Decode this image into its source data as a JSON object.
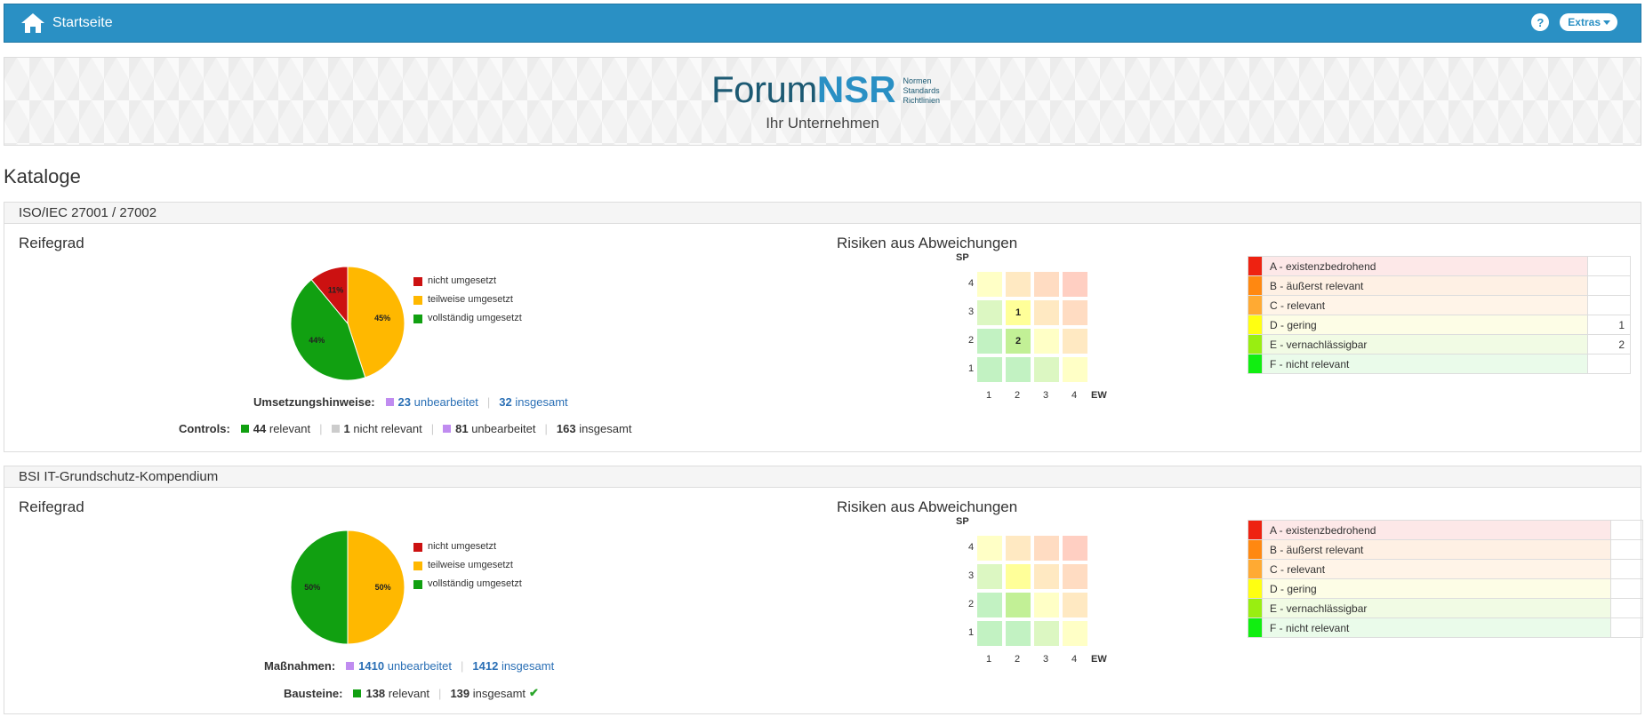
{
  "topbar": {
    "home_label": "Startseite",
    "help_label": "?",
    "extras_label": "Extras"
  },
  "banner": {
    "logo_forum": "Forum",
    "logo_nsr": "NSR",
    "logo_tag": [
      "Normen",
      "Standards",
      "Richtlinien"
    ],
    "company": "Ihr Unternehmen"
  },
  "page_title": "Kataloge",
  "colors": {
    "red": "#cc1111",
    "orange": "#ffb800",
    "green": "#11a011",
    "purple": "#c08cf0",
    "grey": "#cccccc",
    "accent": "#2a90c4"
  },
  "catalogs": [
    {
      "title": "ISO/IEC 27001 / 27002",
      "maturity_title": "Reifegrad",
      "risk_title": "Risiken aus Abweichungen",
      "legend": [
        "nicht umgesetzt",
        "teilweise umgesetzt",
        "vollständig umgesetzt"
      ],
      "pie_labels": [
        "11%",
        "45%",
        "44%"
      ],
      "stats1": {
        "label": "Umsetzungshinweise:",
        "n1": "23",
        "t1": "unbearbeitet",
        "n2": "32",
        "t2": "insgesamt"
      },
      "stats2": {
        "label": "Controls:",
        "n1": "44",
        "t1": "relevant",
        "n2": "1",
        "t2": "nicht relevant",
        "n3": "81",
        "t3": "unbearbeitet",
        "n4": "163",
        "t4": "insgesamt"
      },
      "matrix": {
        "y_label": "SP",
        "x_label": "EW",
        "ticks": [
          "1",
          "2",
          "3",
          "4"
        ],
        "values": {
          "3-2": "1",
          "2-2": "2"
        }
      },
      "risk_classes": [
        {
          "name": "A - existenzbedrohend",
          "count": ""
        },
        {
          "name": "B - äußerst relevant",
          "count": ""
        },
        {
          "name": "C - relevant",
          "count": ""
        },
        {
          "name": "D - gering",
          "count": "1"
        },
        {
          "name": "E - vernachlässigbar",
          "count": "2"
        },
        {
          "name": "F - nicht relevant",
          "count": ""
        }
      ]
    },
    {
      "title": "BSI IT-Grundschutz-Kompendium",
      "maturity_title": "Reifegrad",
      "risk_title": "Risiken aus Abweichungen",
      "legend": [
        "nicht umgesetzt",
        "teilweise umgesetzt",
        "vollständig umgesetzt"
      ],
      "pie_labels": [
        "50%",
        "50%"
      ],
      "stats1": {
        "label": "Maßnahmen:",
        "n1": "1410",
        "t1": "unbearbeitet",
        "n2": "1412",
        "t2": "insgesamt"
      },
      "stats2": {
        "label": "Bausteine:",
        "n1": "138",
        "t1": "relevant",
        "n2": "139",
        "t2": "insgesamt"
      },
      "matrix": {
        "y_label": "SP",
        "x_label": "EW",
        "ticks": [
          "1",
          "2",
          "3",
          "4"
        ],
        "values": {}
      },
      "risk_classes": [
        {
          "name": "A - existenzbedrohend",
          "count": ""
        },
        {
          "name": "B - äußerst relevant",
          "count": ""
        },
        {
          "name": "C - relevant",
          "count": ""
        },
        {
          "name": "D - gering",
          "count": ""
        },
        {
          "name": "E - vernachlässigbar",
          "count": ""
        },
        {
          "name": "F - nicht relevant",
          "count": ""
        }
      ]
    }
  ],
  "chart_data": [
    {
      "type": "pie",
      "title": "Reifegrad",
      "categories": [
        "nicht umgesetzt",
        "teilweise umgesetzt",
        "vollständig umgesetzt"
      ],
      "values": [
        11,
        45,
        44
      ]
    },
    {
      "type": "pie",
      "title": "Reifegrad",
      "categories": [
        "nicht umgesetzt",
        "teilweise umgesetzt",
        "vollständig umgesetzt"
      ],
      "values": [
        0,
        50,
        50
      ]
    }
  ]
}
